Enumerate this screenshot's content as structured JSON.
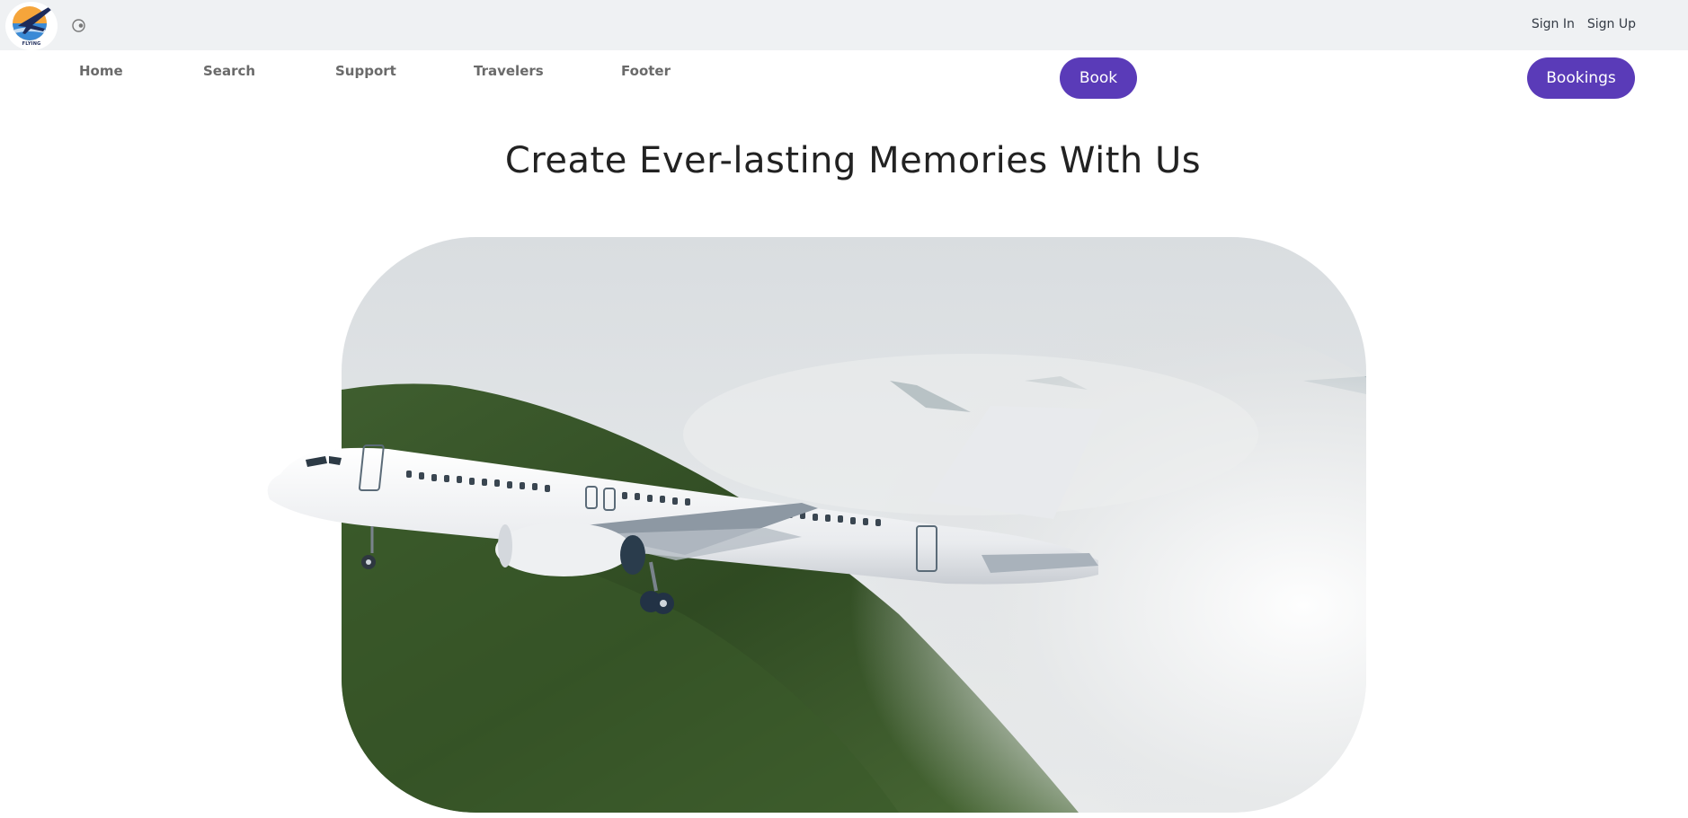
{
  "header": {
    "logo_text": "FLYING",
    "sign_in": "Sign In",
    "sign_up": "Sign Up"
  },
  "nav": {
    "items": [
      "Home",
      "Search",
      "Support",
      "Travelers",
      "Footer"
    ],
    "book_label": "Book",
    "bookings_label": "Bookings"
  },
  "hero": {
    "headline": "Create Ever-lasting Memories With Us"
  },
  "colors": {
    "accent": "#5a3bb8",
    "topbar": "#eff1f3"
  },
  "icons": {
    "theme_toggle": "theme-toggle-icon",
    "logo": "airplane-sunset-logo"
  }
}
